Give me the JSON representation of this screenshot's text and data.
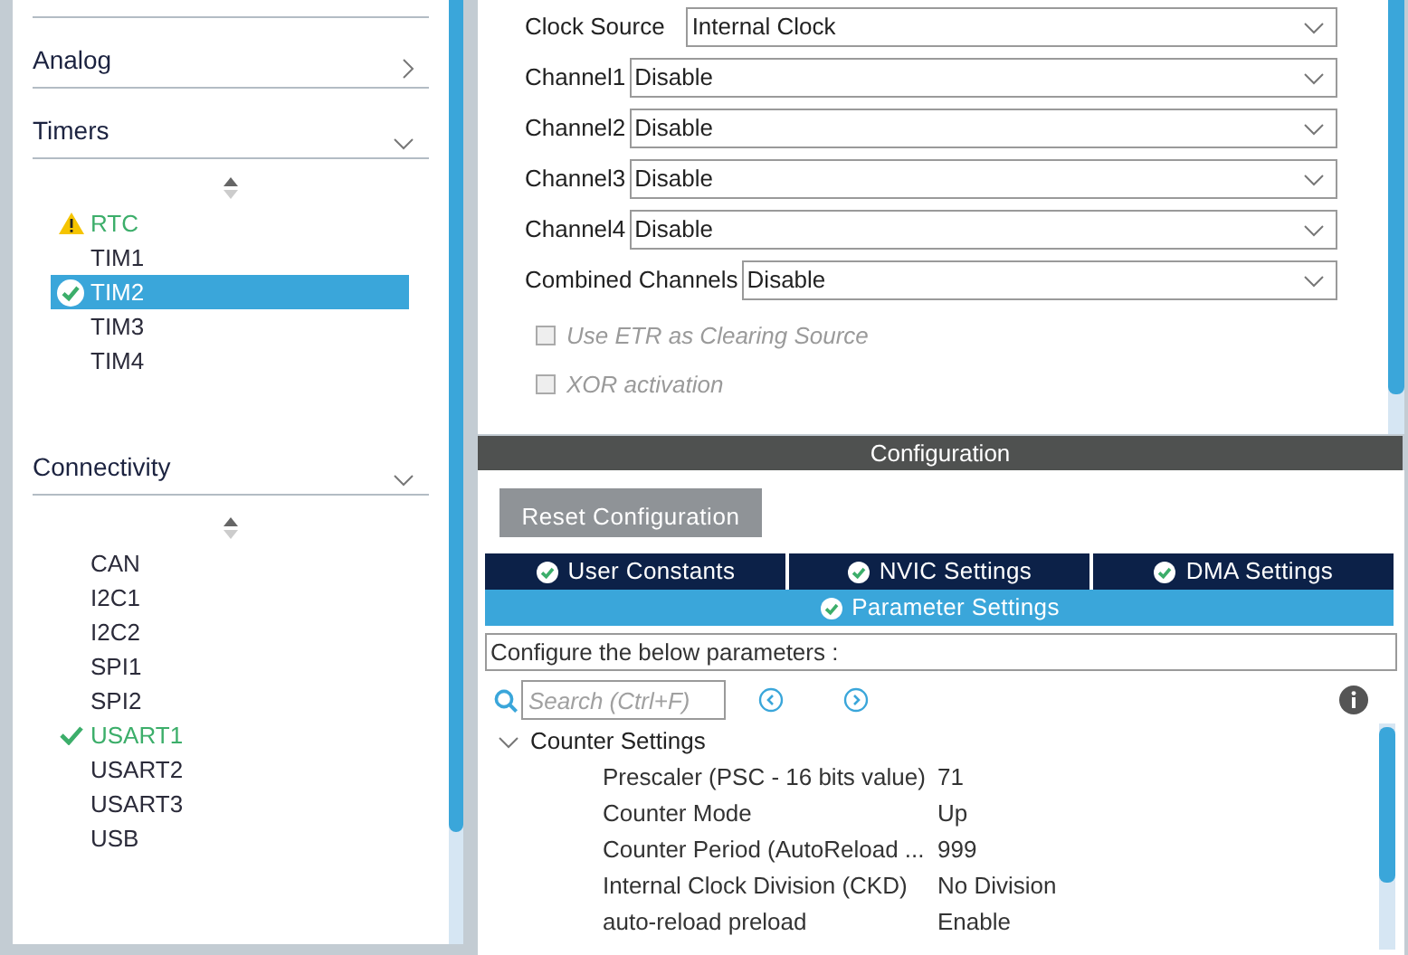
{
  "sidebar": {
    "sections": [
      {
        "label": "Analog",
        "expanded": false
      },
      {
        "label": "Timers",
        "expanded": true,
        "items": [
          {
            "label": "RTC",
            "kind": "warning",
            "selected": false
          },
          {
            "label": "TIM1",
            "kind": "plain",
            "selected": false
          },
          {
            "label": "TIM2",
            "kind": "configured",
            "selected": true
          },
          {
            "label": "TIM3",
            "kind": "plain",
            "selected": false
          },
          {
            "label": "TIM4",
            "kind": "plain",
            "selected": false
          }
        ]
      },
      {
        "label": "Connectivity",
        "expanded": true,
        "items": [
          {
            "label": "CAN",
            "kind": "plain",
            "selected": false
          },
          {
            "label": "I2C1",
            "kind": "plain",
            "selected": false
          },
          {
            "label": "I2C2",
            "kind": "plain",
            "selected": false
          },
          {
            "label": "SPI1",
            "kind": "plain",
            "selected": false
          },
          {
            "label": "SPI2",
            "kind": "plain",
            "selected": false
          },
          {
            "label": "USART1",
            "kind": "configured",
            "selected": false
          },
          {
            "label": "USART2",
            "kind": "plain",
            "selected": false
          },
          {
            "label": "USART3",
            "kind": "plain",
            "selected": false
          },
          {
            "label": "USB",
            "kind": "plain",
            "selected": false
          }
        ]
      }
    ]
  },
  "mode": {
    "fields": [
      {
        "label": "Clock Source",
        "value": "Internal Clock"
      },
      {
        "label": "Channel1",
        "value": "Disable"
      },
      {
        "label": "Channel2",
        "value": "Disable"
      },
      {
        "label": "Channel3",
        "value": "Disable"
      },
      {
        "label": "Channel4",
        "value": "Disable"
      },
      {
        "label": "Combined Channels",
        "value": "Disable"
      }
    ],
    "checkboxes": [
      {
        "label": "Use ETR as Clearing Source",
        "checked": false,
        "disabled": true
      },
      {
        "label": "XOR activation",
        "checked": false,
        "disabled": true
      }
    ]
  },
  "configuration": {
    "title": "Configuration",
    "reset_button": "Reset Configuration",
    "tabs": [
      {
        "label": "User Constants",
        "selected": false
      },
      {
        "label": "NVIC Settings",
        "selected": false
      },
      {
        "label": "DMA Settings",
        "selected": false
      },
      {
        "label": "Parameter Settings",
        "selected": true
      }
    ],
    "description": "Configure the below parameters :",
    "search": {
      "placeholder": "Search (Ctrl+F)"
    },
    "groups": [
      {
        "label": "Counter Settings",
        "expanded": true,
        "params": [
          {
            "label": "Prescaler (PSC - 16 bits value)",
            "value": "71"
          },
          {
            "label": "Counter Mode",
            "value": "Up"
          },
          {
            "label": "Counter Period (AutoReload ...",
            "value": "999"
          },
          {
            "label": "Internal Clock Division (CKD)",
            "value": "No Division"
          },
          {
            "label": "auto-reload preload",
            "value": "Enable"
          }
        ]
      }
    ]
  }
}
